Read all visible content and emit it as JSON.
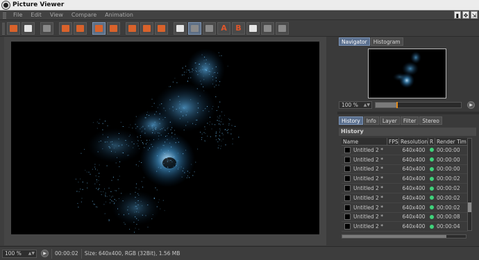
{
  "window": {
    "title": "Picture Viewer"
  },
  "menu": [
    "File",
    "Edit",
    "View",
    "Compare",
    "Animation"
  ],
  "navigator": {
    "tabs": [
      "Navigator",
      "Histogram"
    ],
    "zoom": "100 %",
    "timeline_fraction": 0.24
  },
  "history": {
    "tabs": [
      "History",
      "Info",
      "Layer",
      "Filter",
      "Stereo"
    ],
    "header": "History",
    "columns": [
      "Name",
      "FPS",
      "Resolution",
      "R",
      "Render Tim"
    ],
    "rows": [
      {
        "name": "Untitled 2 *",
        "resolution": "640x400",
        "time": "00:00:00"
      },
      {
        "name": "Untitled 2 *",
        "resolution": "640x400",
        "time": "00:00:00"
      },
      {
        "name": "Untitled 2 *",
        "resolution": "640x400",
        "time": "00:00:00"
      },
      {
        "name": "Untitled 2 *",
        "resolution": "640x400",
        "time": "00:00:02"
      },
      {
        "name": "Untitled 2 *",
        "resolution": "640x400",
        "time": "00:00:02"
      },
      {
        "name": "Untitled 2 *",
        "resolution": "640x400",
        "time": "00:00:02"
      },
      {
        "name": "Untitled 2 *",
        "resolution": "640x400",
        "time": "00:00:02"
      },
      {
        "name": "Untitled 2 *",
        "resolution": "640x400",
        "time": "00:00:08"
      },
      {
        "name": "Untitled 2 *",
        "resolution": "640x400",
        "time": "00:00:04"
      }
    ],
    "status_color": "#3fd37a"
  },
  "status": {
    "zoom": "100 %",
    "time": "00:00:02",
    "info": "Size: 640x400, RGB (32Bit), 1.56 MB"
  }
}
